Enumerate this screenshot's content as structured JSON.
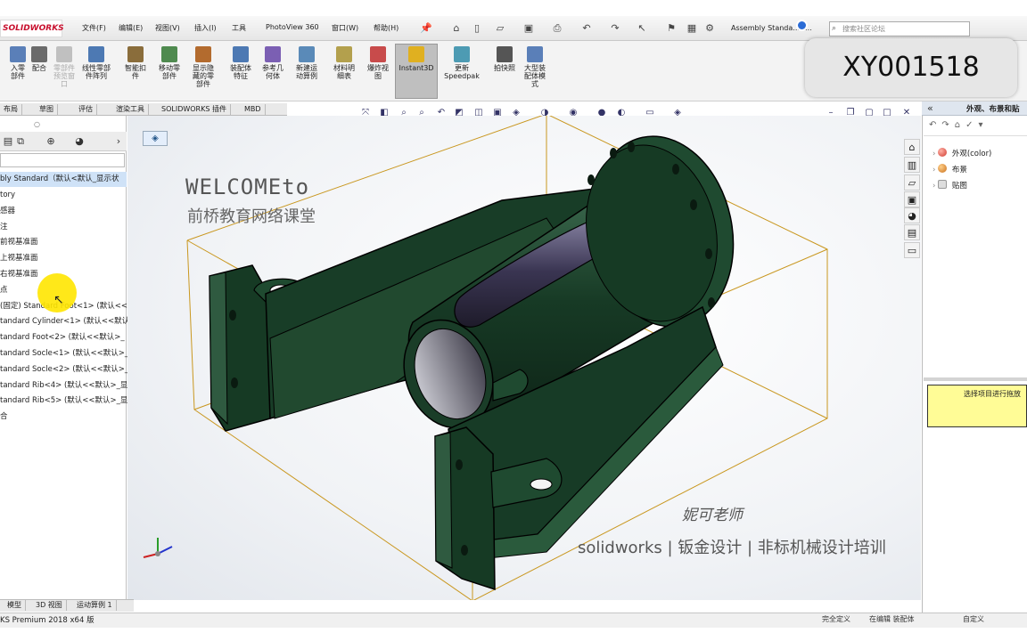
{
  "app": {
    "logo_text": "SOLIDWORKS",
    "document_title": "Assembly Standa...D...",
    "search_placeholder": "搜索社区论坛",
    "status_text": "KS Premium 2018 x64 版"
  },
  "menu": [
    "文件(F)",
    "编辑(E)",
    "视图(V)",
    "插入(I)",
    "工具",
    "PhotoView 360",
    "窗口(W)",
    "帮助(H)"
  ],
  "ribbon": {
    "buttons": [
      {
        "label": "入零\n部件",
        "icon_color": "#5a7fb8"
      },
      {
        "label": "配合",
        "icon_color": "#6b6b6b"
      },
      {
        "label": "零部件\n预览窗\n口",
        "icon_color": "#c0c0c0",
        "dim": true
      },
      {
        "label": "线性零部\n件阵列",
        "icon_color": "#4d79b3"
      },
      {
        "label": "智能扣\n件",
        "icon_color": "#8a6d3b"
      },
      {
        "label": "移动零\n部件",
        "icon_color": "#4f8a4f"
      },
      {
        "label": "显示隐\n藏的零\n部件",
        "icon_color": "#b36b2e"
      },
      {
        "label": "装配体\n特征",
        "icon_color": "#4d79b3"
      },
      {
        "label": "参考几\n何体",
        "icon_color": "#7b5fb3"
      },
      {
        "label": "新建运\n动算例",
        "icon_color": "#5a8ab8"
      },
      {
        "label": "材料明\n细表",
        "icon_color": "#b3a04d"
      },
      {
        "label": "爆炸视\n图",
        "icon_color": "#c84b4b"
      },
      {
        "label": "Instant3D",
        "icon_color": "#e0b020"
      },
      {
        "label": "更新\nSpeedpak",
        "icon_color": "#4d9bb3"
      },
      {
        "label": "拍快照",
        "icon_color": "#555555"
      },
      {
        "label": "大型装\n配体模\n式",
        "icon_color": "#5a7fb8"
      }
    ]
  },
  "badge": {
    "text": "XY001518"
  },
  "command_tabs": [
    "布局",
    "草图",
    "评估",
    "渲染工具",
    "SOLIDWORKS 插件",
    "MBD"
  ],
  "feature_tree": {
    "root": "bly Standard（默认<默认_显示状",
    "rows": [
      "tory",
      "感器",
      "注",
      "前视基准面",
      "上视基准面",
      "右视基准面",
      "点",
      "(固定) Standard Foot<1> (默认<<默认",
      "tandard Cylinder<1> (默认<<默认",
      "tandard Foot<2> (默认<<默认>_",
      "tandard Socle<1> (默认<<默认>_",
      "tandard Socle<2> (默认<<默认>_",
      "tandard Rib<4> (默认<<默认>_显",
      "tandard Rib<5> (默认<<默认>_显",
      "合"
    ]
  },
  "bottom_tabs": [
    "模型",
    "3D 视图",
    "运动算例 1"
  ],
  "status_right": [
    "完全定义",
    "在编辑 装配体",
    "自定义"
  ],
  "viewport": {
    "welcome_line1": "WELCOMEto",
    "welcome_line2": "前桥教育网络课堂",
    "signature": "妮可老师",
    "brand": "solidworks | 钣金设计 | 非标机械设计培训"
  },
  "task_pane": {
    "title": "外观、布景和贴",
    "items": [
      {
        "label": "外观(color)",
        "ball_color": "#d03a2f"
      },
      {
        "label": "布景",
        "ball_color": "#3b7cc9"
      },
      {
        "label": "贴图",
        "ball_color": "#8a8a8a"
      }
    ],
    "hint": "选择项目进行拖放"
  },
  "colors": {
    "model_green": "#1e4a30",
    "bbox_yellow": "#d4a017",
    "accent_blue": "#2b6cd6",
    "hint_yellow": "#fffc96"
  }
}
